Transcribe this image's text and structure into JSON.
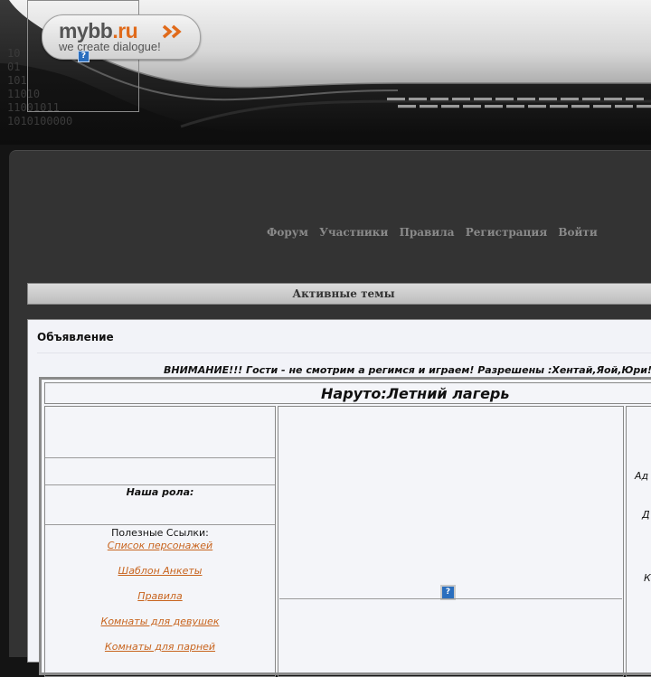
{
  "header": {
    "logo": {
      "brand": "mybb",
      "domain": ".ru",
      "tagline": "we create dialogue!",
      "help_icon": "question-icon"
    },
    "binary_lines": [
      "10",
      "01",
      "101",
      "11010",
      "11001011",
      "1010100000"
    ]
  },
  "nav": {
    "links": [
      "Форум",
      "Участники",
      "Правила",
      "Регистрация",
      "Войти"
    ]
  },
  "active_topics_label": "Активные темы",
  "announcement": {
    "title": "Объявление",
    "warning": "ВНИМАНИЕ!!! Гости - не смотрим а регимся и играем! Разрешены :Хентай,Яой,Юри!",
    "site_title": "Наруто:Летний лагерь",
    "left": {
      "our_role_label": "Наша рола:",
      "useful_links_label": "Полезные Ссылки:",
      "links": [
        "Список персонажей",
        "Шаблон Анкеты",
        "Правила",
        "Комнаты для девушек",
        "Комнаты для парней"
      ]
    },
    "middle": {
      "image_icon": "question-icon"
    },
    "right": {
      "fragments": [
        "Ад",
        "Д",
        "К"
      ]
    }
  },
  "colors": {
    "link": "#c8641e",
    "logo_accent": "#e06a1a",
    "nav_text": "#8a8a8a"
  }
}
